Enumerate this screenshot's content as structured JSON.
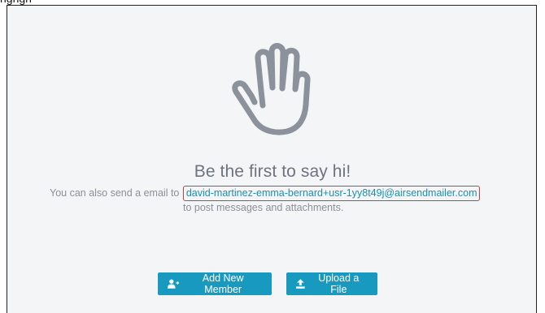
{
  "header": {
    "cropped_text": "ngngn"
  },
  "empty_state": {
    "icon": "waving-hand-icon",
    "title": "Be the first to say hi!",
    "email_prefix": "You can also send a email to",
    "email_address": "david-martinez-emma-bernard+usr-1yy8t49j@airsendmailer.com",
    "email_suffix": "to post messages and attachments."
  },
  "actions": {
    "add_member_label": "Add New Member",
    "add_member_icon": "user-plus-icon",
    "upload_label": "Upload a File",
    "upload_icon": "upload-icon"
  },
  "colors": {
    "accent": "#1899bf",
    "link": "#1692b8",
    "highlight_border": "#e53238",
    "background": "#f4f5f7",
    "muted_text": "#8a8f99",
    "icon_gray": "#8b929c"
  }
}
